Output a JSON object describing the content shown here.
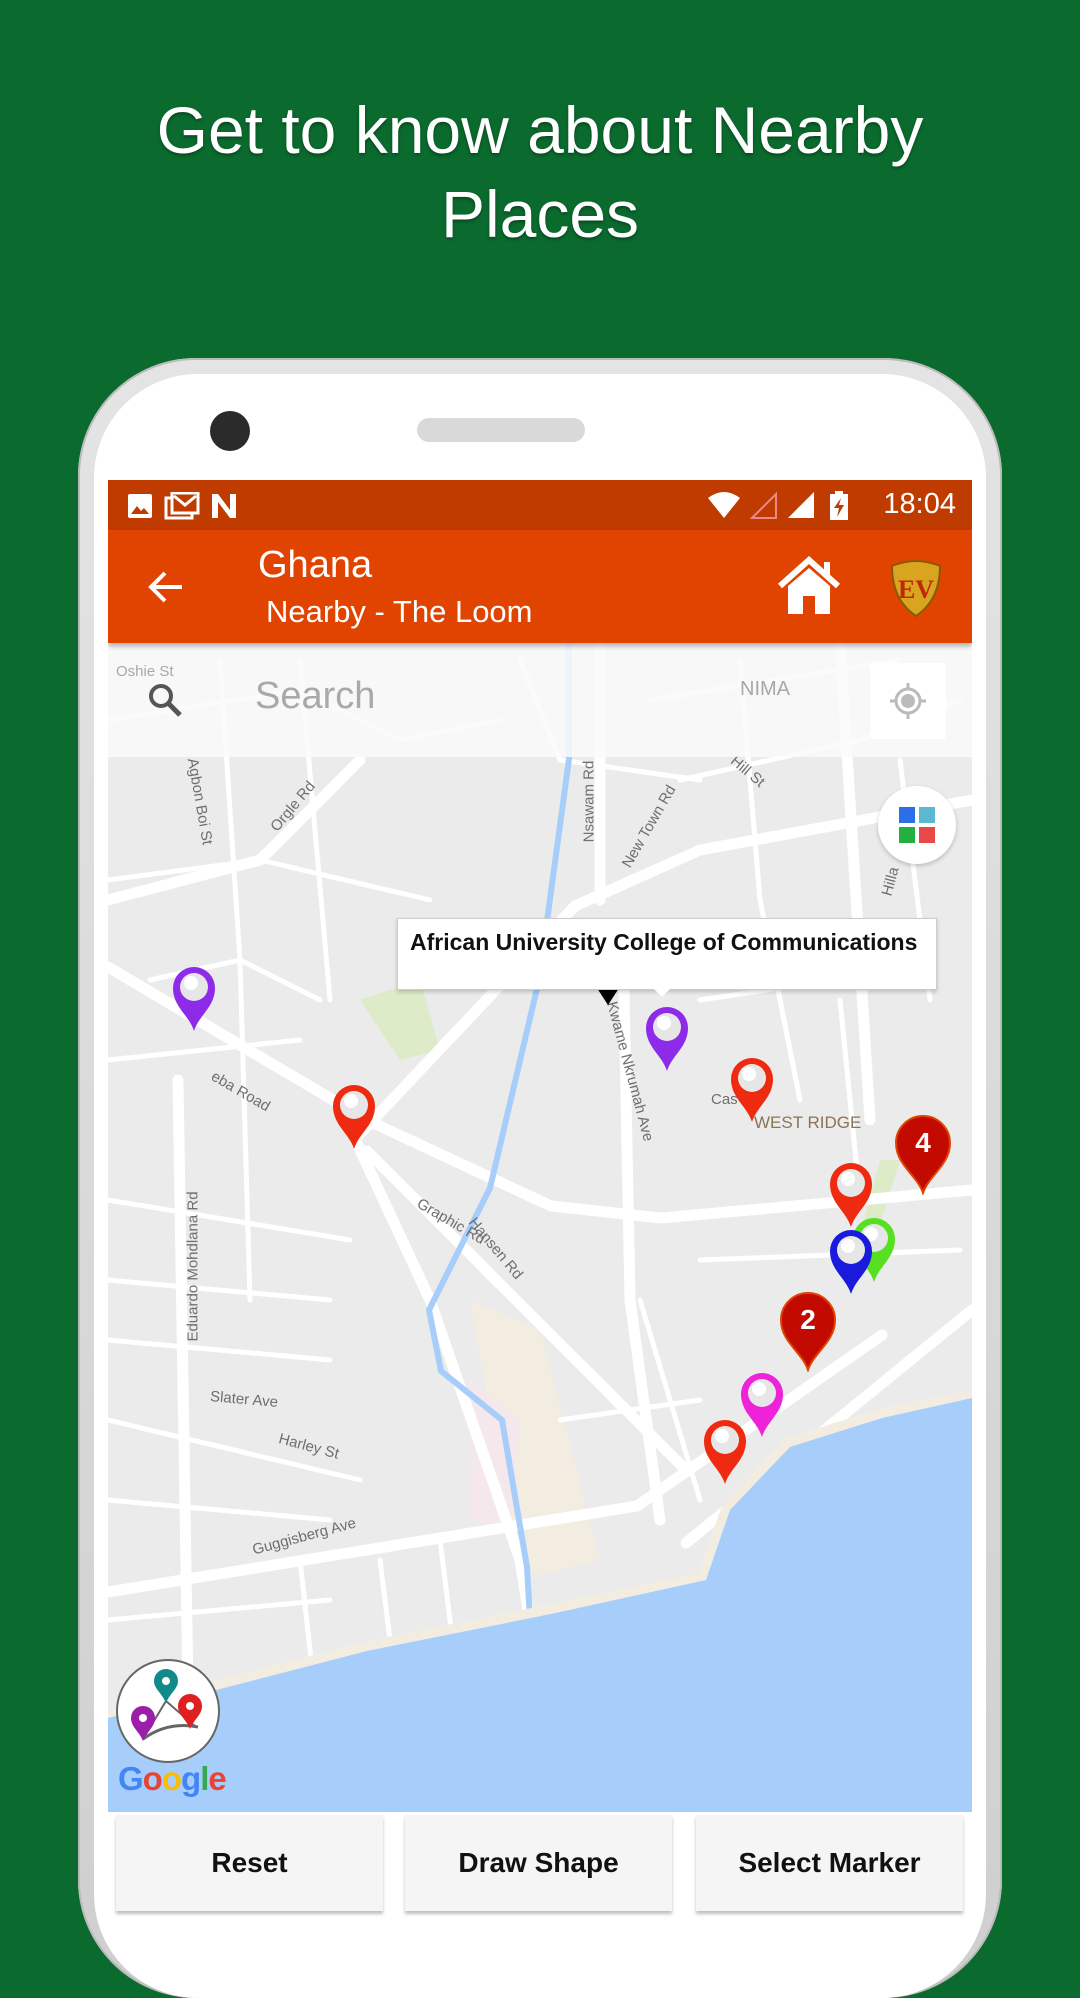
{
  "headline": {
    "line1": "Get to know about Nearby",
    "line2": "Places"
  },
  "status_bar": {
    "time": "18:04",
    "icons_left": [
      "image-icon",
      "gmail-icon",
      "n-app-icon"
    ],
    "icons_right": [
      "wifi-icon",
      "signal-empty-icon",
      "signal-full-icon",
      "battery-charging-icon"
    ]
  },
  "app_bar": {
    "title": "Ghana",
    "subtitle": "Nearby - The Loom",
    "back_icon": "arrow-left-icon",
    "home_icon": "home-icon",
    "logo": "EV"
  },
  "search": {
    "placeholder": "Search"
  },
  "map": {
    "labels": [
      "Oshie St",
      "NIMA",
      "Agbon Boi St",
      "Orgle Rd",
      "Nsawam Rd",
      "New Town Rd",
      "Hill St",
      "Hilla",
      "eba Road",
      "Graphic Rd",
      "Kwame Nkrumah Ave",
      "Cas",
      "WEST RIDGE",
      "Eduardo Mohdlana Rd",
      "Hansen Rd",
      "Slater Ave",
      "Harley St",
      "Guggisberg Ave"
    ],
    "info_window": "African University College of Communications",
    "clusters": [
      "4",
      "2"
    ],
    "colors": {
      "water": "#A7CDFB",
      "road": "#FFFFFF",
      "land": "#EBEBEB",
      "cluster": "#C20A00"
    }
  },
  "google_logo": "Google",
  "buttons": {
    "reset": "Reset",
    "draw_shape": "Draw Shape",
    "select_marker": "Select Marker"
  },
  "colors": {
    "background": "#0B6B2E",
    "status_bar": "#BF3B00",
    "app_bar": "#E04400"
  }
}
